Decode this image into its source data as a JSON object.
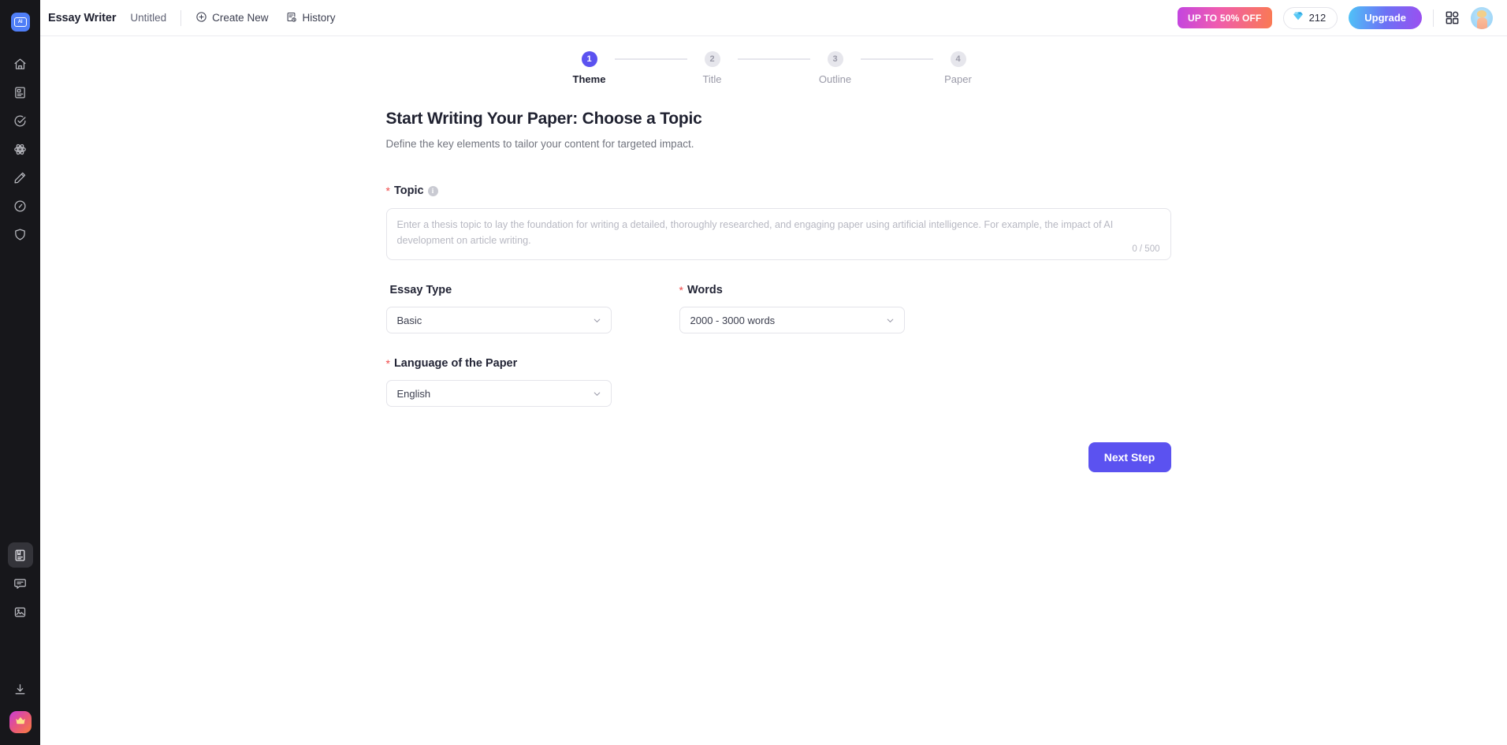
{
  "app": {
    "logo_text": "AI",
    "accent_color": "#5b52f0",
    "sidebar_bg": "#17171b"
  },
  "sidebar": {
    "top_items": [
      {
        "name": "home-icon",
        "label": "Home"
      },
      {
        "name": "document-icon",
        "label": "Documents"
      },
      {
        "name": "check-circle-icon",
        "label": "Tasks"
      },
      {
        "name": "atom-icon",
        "label": "AI Tools"
      },
      {
        "name": "pencil-icon",
        "label": "Write"
      },
      {
        "name": "gauge-icon",
        "label": "Detector"
      },
      {
        "name": "shield-icon",
        "label": "Protect"
      }
    ],
    "bottom_items": [
      {
        "name": "book-icon",
        "label": "Library",
        "active": true
      },
      {
        "name": "chat-icon",
        "label": "Chat",
        "active": false
      },
      {
        "name": "image-icon",
        "label": "Images",
        "active": false
      }
    ],
    "utility_items": [
      {
        "name": "download-icon",
        "label": "Download"
      },
      {
        "name": "crown-icon",
        "label": "Premium"
      }
    ]
  },
  "header": {
    "title": "Essay Writer",
    "document_name": "Untitled",
    "create_new_label": "Create New",
    "history_label": "History",
    "promo_label": "UP TO 50% OFF",
    "credits": "212",
    "upgrade_label": "Upgrade",
    "promo_gradient_start": "#c345e0",
    "promo_gradient_end": "#fa7a53",
    "upgrade_gradient_start": "#4fc3f7",
    "upgrade_gradient_end": "#9b4ff0"
  },
  "stepper": {
    "steps": [
      {
        "number": "1",
        "label": "Theme",
        "active": true
      },
      {
        "number": "2",
        "label": "Title",
        "active": false
      },
      {
        "number": "3",
        "label": "Outline",
        "active": false
      },
      {
        "number": "4",
        "label": "Paper",
        "active": false
      }
    ]
  },
  "main": {
    "title": "Start Writing Your Paper: Choose a Topic",
    "subtitle": "Define the key elements to tailor your content for targeted impact.",
    "topic": {
      "label": "Topic",
      "required": "*",
      "info_glyph": "i",
      "value": "",
      "placeholder": "Enter a thesis topic to lay the foundation for writing a detailed, thoroughly researched, and engaging paper using artificial intelligence. For example, the impact of AI development on article writing.",
      "counter": "0 / 500"
    },
    "essay_type": {
      "label": "Essay Type",
      "required": "",
      "value": "Basic"
    },
    "words": {
      "label": "Words",
      "required": "*",
      "value": "2000 - 3000 words"
    },
    "language": {
      "label": "Language of the Paper",
      "required": "*",
      "value": "English"
    },
    "next_button": "Next Step"
  }
}
